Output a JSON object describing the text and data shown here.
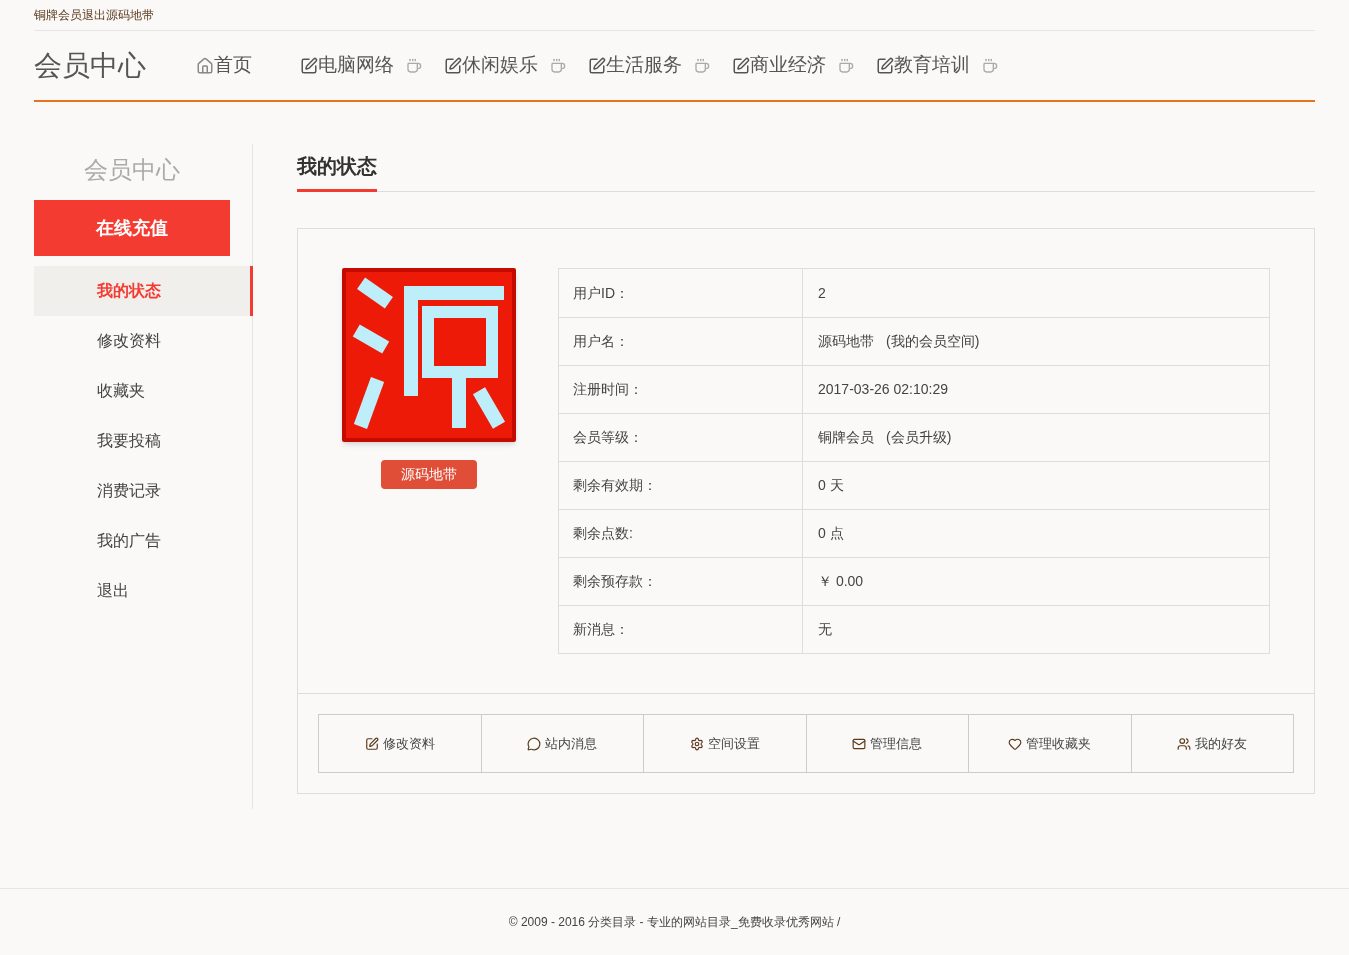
{
  "topbar": {
    "links": [
      "铜牌会员",
      "退出",
      "源码地带"
    ]
  },
  "header": {
    "title": "会员中心",
    "nav": [
      {
        "label": "首页",
        "kind": "home"
      },
      {
        "label": "电脑网络",
        "kind": "category"
      },
      {
        "label": "休闲娱乐",
        "kind": "category"
      },
      {
        "label": "生活服务",
        "kind": "category"
      },
      {
        "label": "商业经济",
        "kind": "category"
      },
      {
        "label": "教育培训",
        "kind": "category"
      }
    ]
  },
  "sidebar": {
    "title": "会员中心",
    "recharge": "在线充值",
    "items": [
      {
        "label": "我的状态",
        "selected": true
      },
      {
        "label": "修改资料",
        "selected": false
      },
      {
        "label": "收藏夹",
        "selected": false
      },
      {
        "label": "我要投稿",
        "selected": false
      },
      {
        "label": "消费记录",
        "selected": false
      },
      {
        "label": "我的广告",
        "selected": false
      },
      {
        "label": "退出",
        "selected": false
      }
    ]
  },
  "main": {
    "heading": "我的状态",
    "username_badge": "源码地带",
    "rows": [
      {
        "label": "用户ID：",
        "value": "2"
      },
      {
        "label": "用户名：",
        "value": "源码地带",
        "extra": "(我的会员空间)"
      },
      {
        "label": "注册时间：",
        "value": "2017-03-26 02:10:29"
      },
      {
        "label": "会员等级：",
        "value": "铜牌会员",
        "extra": "(会员升级)"
      },
      {
        "label": "剩余有效期：",
        "value": "0 天"
      },
      {
        "label": "剩余点数:",
        "value": "0 点"
      },
      {
        "label": "剩余预存款：",
        "value": "￥ 0.00"
      },
      {
        "label": "新消息：",
        "value": "无"
      }
    ],
    "actions": [
      {
        "label": "修改资料",
        "kind": "edit"
      },
      {
        "label": "站内消息",
        "kind": "message"
      },
      {
        "label": "空间设置",
        "kind": "settings"
      },
      {
        "label": "管理信息",
        "kind": "mail"
      },
      {
        "label": "管理收藏夹",
        "kind": "favorite"
      },
      {
        "label": "我的好友",
        "kind": "friends"
      }
    ]
  },
  "footer": "© 2009 - 2016 分类目录 - 专业的网站目录_免费收录优秀网站 /"
}
